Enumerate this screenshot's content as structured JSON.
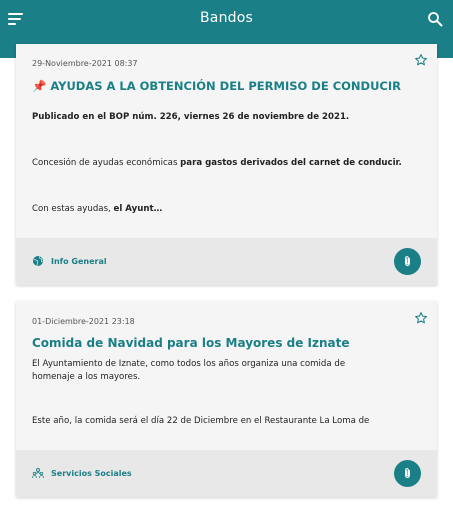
{
  "header": {
    "title": "Bandos",
    "menu_icon": "menu-icon",
    "search_icon": "search-icon"
  },
  "colors": {
    "primary": "#1a7f86",
    "card_bg": "#f5f5f5",
    "footer_bg": "#e8e8e8",
    "pin": "#c62828"
  },
  "posts": [
    {
      "date": "29-Noviembre-2021 08:37",
      "title_icon": "pushpin-icon",
      "title": "AYUDAS A LA OBTENCIÓN DEL PERMISO DE CONDUCIR",
      "line1": "Publicado en el BOP núm. 226, viernes 26 de noviembre de 2021.",
      "line2_a": "Concesión de ayudas económicas ",
      "line2_b": "para gastos derivados del carnet de conducir.",
      "line3_a": "Con estas ayudas, ",
      "line3_b": "el Ayunt…",
      "category": "Info General",
      "category_icon": "globe-icon"
    },
    {
      "date": "01-Diciembre-2021 23:18",
      "title": "Comida de Navidad para los Mayores de Iznate",
      "line1": "El Ayuntamiento de Iznate, como todos los años organiza una comida de",
      "line2": "homenaje a los mayores.",
      "line3": "Este año, la comida será el día 22 de Diciembre en el Restaurante La Loma de",
      "category": "Servicios Sociales",
      "category_icon": "people-icon"
    }
  ]
}
